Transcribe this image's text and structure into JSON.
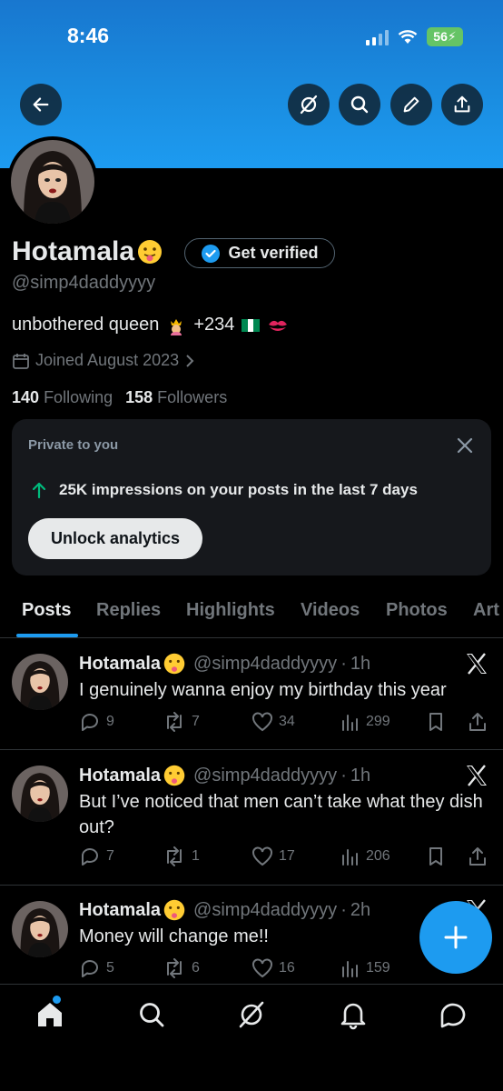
{
  "status_bar": {
    "time": "8:46",
    "battery": "56"
  },
  "profile": {
    "name": "Hotamala",
    "handle": "@simp4daddyyyy",
    "verify_label": "Get verified",
    "bio_text": "unbothered queen",
    "bio_code": "+234",
    "joined": "Joined August 2023",
    "following_count": "140",
    "following_label": "Following",
    "followers_count": "158",
    "followers_label": "Followers"
  },
  "private_card": {
    "title": "Private to you",
    "impressions": "25K impressions on your posts in the last 7 days",
    "button": "Unlock analytics"
  },
  "tabs": [
    "Posts",
    "Replies",
    "Highlights",
    "Videos",
    "Photos",
    "Art"
  ],
  "posts": [
    {
      "name": "Hotamala",
      "handle": "@simp4daddyyyy",
      "time": "1h",
      "text": "I genuinely wanna enjoy my birthday this year",
      "replies": "9",
      "reposts": "7",
      "likes": "34",
      "views": "299"
    },
    {
      "name": "Hotamala",
      "handle": "@simp4daddyyyy",
      "time": "1h",
      "text": "But I’ve noticed that men can’t take what they dish out?",
      "replies": "7",
      "reposts": "1",
      "likes": "17",
      "views": "206"
    },
    {
      "name": "Hotamala",
      "handle": "@simp4daddyyyy",
      "time": "2h",
      "text": "Money will change me!!",
      "replies": "5",
      "reposts": "6",
      "likes": "16",
      "views": "159"
    }
  ],
  "colors": {
    "accent": "#1d9bf0",
    "banner": "#1a8ce0",
    "background": "#000000",
    "muted": "#71767b"
  }
}
